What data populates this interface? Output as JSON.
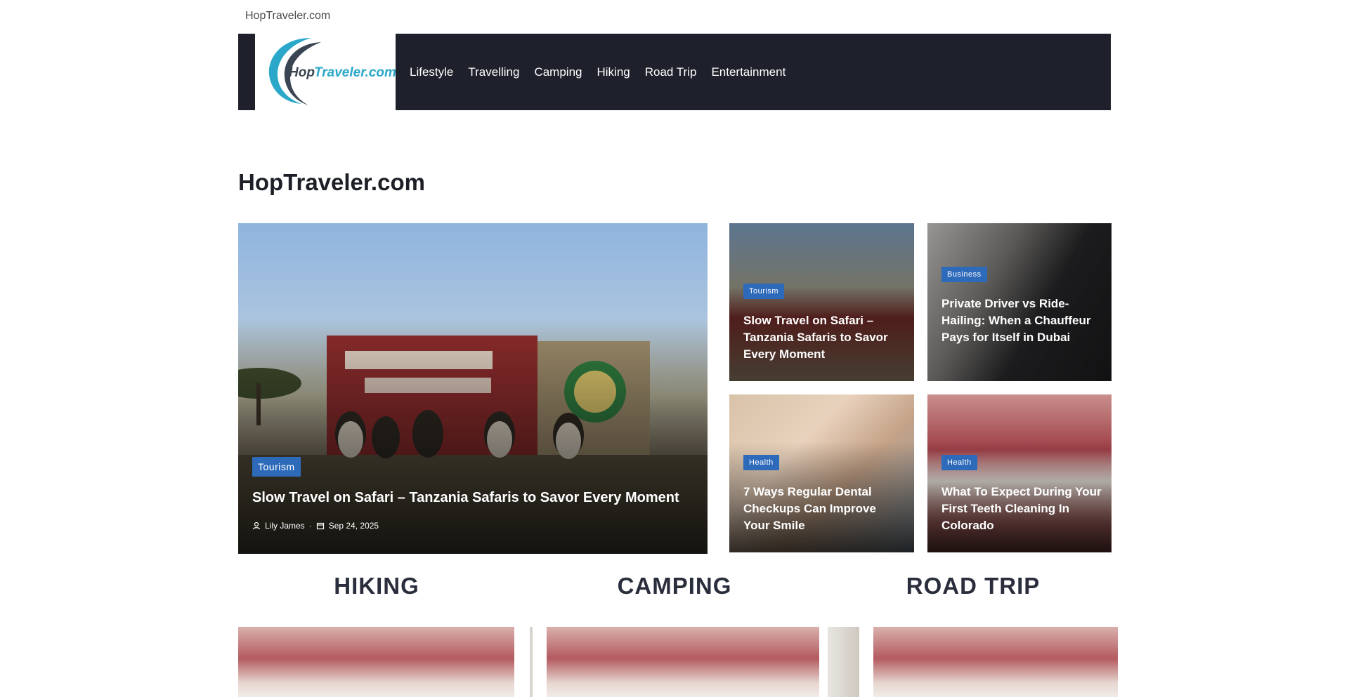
{
  "site": {
    "top_label": "HopTraveler.com",
    "logo_text_a": "Hop",
    "logo_text_b": "Traveler.com"
  },
  "nav": {
    "items": [
      "Lifestyle",
      "Travelling",
      "Camping",
      "Hiking",
      "Road Trip",
      "Entertainment"
    ]
  },
  "page": {
    "title": "HopTraveler.com"
  },
  "featured": {
    "main": {
      "category": "Tourism",
      "title": "Slow Travel on Safari – Tanzania Safaris to Savor Every Moment",
      "author": "Lily James",
      "date": "Sep 24, 2025"
    },
    "cards": [
      {
        "category": "Tourism",
        "title": "Slow Travel on Safari – Tanzania Safaris to Savor Every Moment"
      },
      {
        "category": "Business",
        "title": "Private Driver vs Ride-Hailing: When a Chauffeur Pays for Itself in Dubai"
      },
      {
        "category": "Health",
        "title": "7 Ways Regular Dental Checkups Can Improve Your Smile"
      },
      {
        "category": "Health",
        "title": "What To Expect During Your First Teeth Cleaning In Colorado"
      }
    ]
  },
  "sections": [
    "HIKING",
    "CAMPING",
    "ROAD TRIP"
  ],
  "colors": {
    "nav_bg": "#1e202b",
    "badge": "#2e6aba",
    "accent_logo": "#2aa7c9"
  },
  "icons": {
    "author": "user-icon",
    "date": "calendar-icon"
  }
}
